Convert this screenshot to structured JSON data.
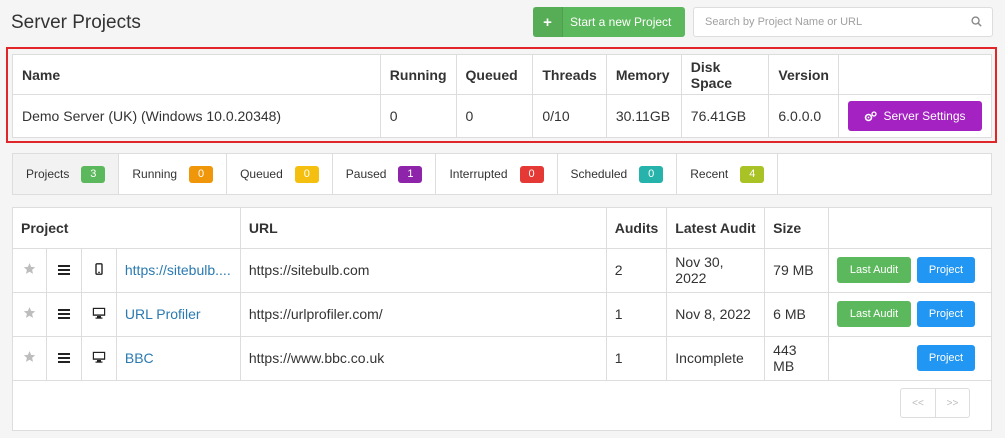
{
  "header": {
    "title": "Server Projects",
    "new_project_label": "Start a new Project",
    "search_placeholder": "Search by Project Name or URL"
  },
  "server": {
    "columns": [
      "Name",
      "Running",
      "Queued",
      "Threads",
      "Memory",
      "Disk Space",
      "Version"
    ],
    "row": {
      "name": "Demo Server (UK) (Windows 10.0.20348)",
      "running": "0",
      "queued": "0",
      "threads": "0/10",
      "memory": "30.11GB",
      "disk_space": "76.41GB",
      "version": "6.0.0.0"
    },
    "settings_label": "Server Settings"
  },
  "filters": [
    {
      "label": "Projects",
      "count": "3",
      "color": "#5cb85c"
    },
    {
      "label": "Running",
      "count": "0",
      "color": "#f0960a"
    },
    {
      "label": "Queued",
      "count": "0",
      "color": "#f5bf0f"
    },
    {
      "label": "Paused",
      "count": "1",
      "color": "#8e24aa"
    },
    {
      "label": "Interrupted",
      "count": "0",
      "color": "#e53935"
    },
    {
      "label": "Scheduled",
      "count": "0",
      "color": "#26b3ab"
    },
    {
      "label": "Recent",
      "count": "4",
      "color": "#a9c225"
    }
  ],
  "projects": {
    "columns": [
      "Project",
      "URL",
      "Audits",
      "Latest Audit",
      "Size"
    ],
    "last_audit_label": "Last Audit",
    "project_label": "Project",
    "rows": [
      {
        "name": "https://sitebulb....",
        "url": "https://sitebulb.com",
        "audits": "2",
        "latest": "Nov 30, 2022",
        "size": "79 MB",
        "device": "mobile-icon"
      },
      {
        "name": "URL Profiler",
        "url": "https://urlprofiler.com/",
        "audits": "1",
        "latest": "Nov 8, 2022",
        "size": "6 MB",
        "device": "desktop-icon"
      },
      {
        "name": "BBC",
        "url": "https://www.bbc.co.uk",
        "audits": "1",
        "latest": "Incomplete",
        "size": "443 MB",
        "device": "desktop-icon"
      }
    ]
  },
  "pager": {
    "prev": "<<",
    "next": ">>"
  }
}
